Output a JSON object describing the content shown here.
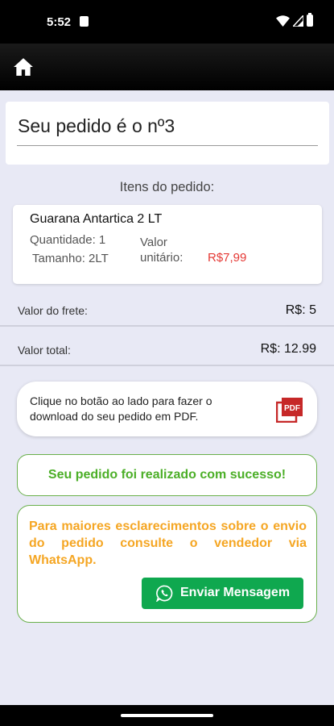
{
  "status_bar": {
    "time": "5:52"
  },
  "order": {
    "title": "Seu pedido é o nº3"
  },
  "items": {
    "heading": "Itens do pedido:",
    "list": [
      {
        "name": "Guarana Antartica 2 LT",
        "quantity": "Quantidade:  1",
        "size": "Tamanho: 2LT",
        "unit_label": "Valor unitário:",
        "price": "R$7,99"
      }
    ]
  },
  "shipping": {
    "label": "Valor do frete:",
    "value": "R$: 5"
  },
  "total": {
    "label": "Valor total:",
    "value": "R$: 12.99"
  },
  "pdf": {
    "text": "Clique no botão ao lado para fazer o download do seu pedido em PDF."
  },
  "success": {
    "text": "Seu pedido foi realizado com sucesso!"
  },
  "info": {
    "text": "Para maiores esclarecimentos sobre o envio do pedido consulte o vendedor via WhatsApp.",
    "button_label": "Enviar Mensagem"
  },
  "colors": {
    "price_red": "#e53935",
    "success_green": "#4caf28",
    "info_orange": "#f5a623",
    "whatsapp_green": "#0fa84f",
    "background": "#e8e9f5"
  }
}
